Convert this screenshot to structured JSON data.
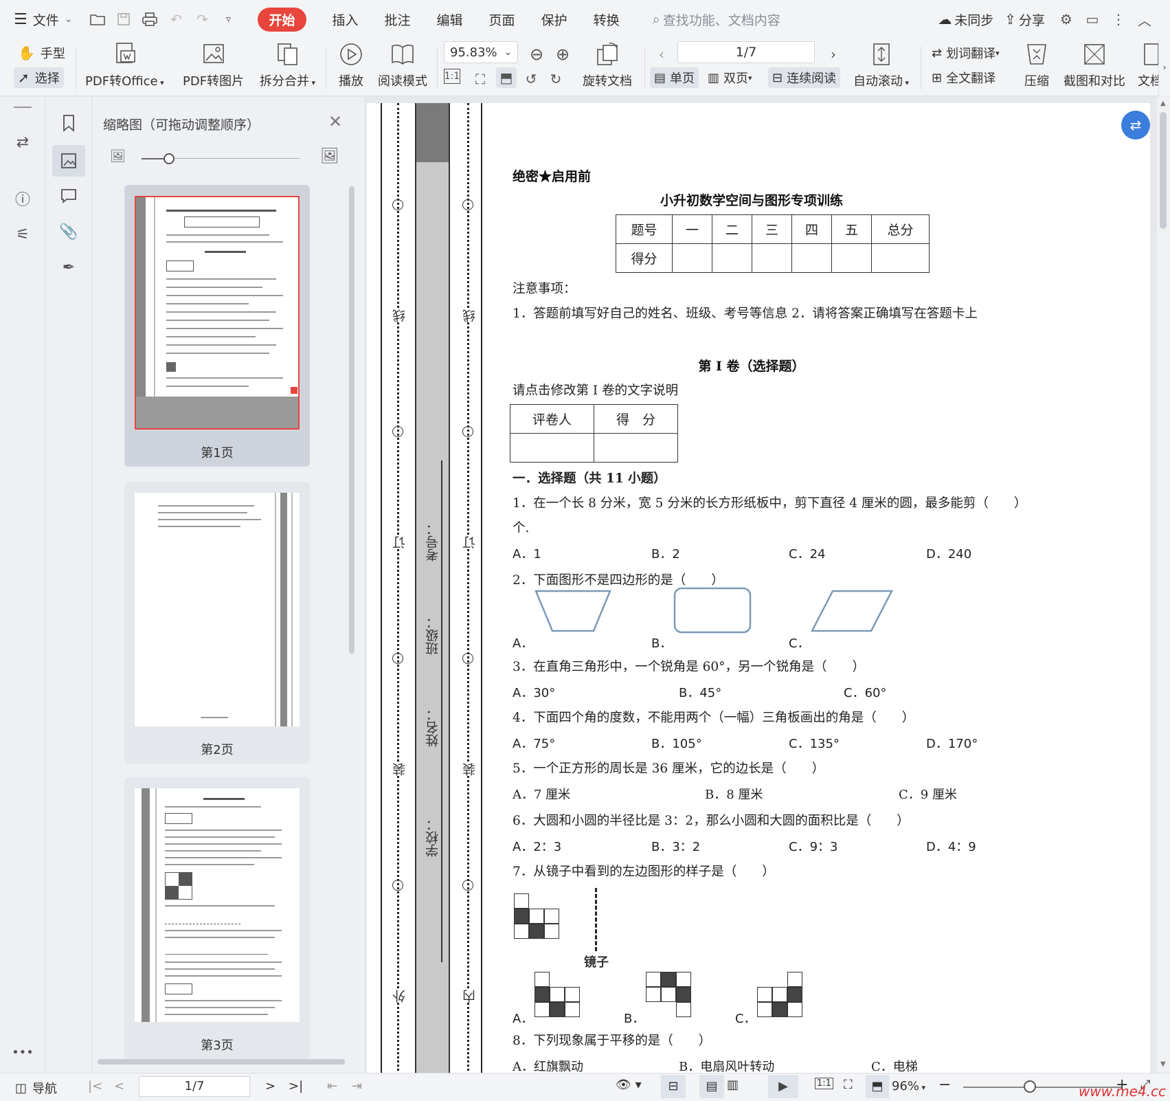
{
  "menu": {
    "file": "文件",
    "tabs": [
      "开始",
      "插入",
      "批注",
      "编辑",
      "页面",
      "保护",
      "转换"
    ],
    "active_tab": "开始",
    "search_placeholder": "查找功能、文档内容",
    "sync": "未同步",
    "share": "分享"
  },
  "ribbon": {
    "hand": "手型",
    "select": "选择",
    "pdf_to_office": "PDF转Office",
    "pdf_to_image": "PDF转图片",
    "split_merge": "拆分合并",
    "play": "播放",
    "read_mode": "阅读模式",
    "zoom": "95.83%",
    "rotate": "旋转文档",
    "page_input": "1/7",
    "single": "单页",
    "double": "双页",
    "continuous": "连续阅读",
    "auto_scroll": "自动滚动",
    "word_translate": "划词翻译",
    "full_translate": "全文翻译",
    "compress": "压缩",
    "screenshot_compare": "截图和对比",
    "doc_cut": "文档"
  },
  "thumbnail_panel": {
    "title": "缩略图（可拖动调整顺序）",
    "pages": [
      "第1页",
      "第2页",
      "第3页"
    ]
  },
  "paper": {
    "secret": "绝密★启用前",
    "title": "小升初数学空间与图形专项训练",
    "score_table": {
      "headers": [
        "题号",
        "一",
        "二",
        "三",
        "四",
        "五",
        "总分"
      ],
      "row2": [
        "得分",
        "",
        "",
        "",
        "",
        "",
        ""
      ]
    },
    "notice_title": "注意事项：",
    "notice": "1．答题前填写好自己的姓名、班级、考号等信息 2．请将答案正确填写在答题卡上",
    "part1_title": "第 I 卷（选择题）",
    "part1_desc": "请点击修改第 I 卷的文字说明",
    "grader": [
      "评卷人",
      "得　分"
    ],
    "section1": "一．选择题（共 11 小题）",
    "q1": "1．在一个长 8 分米，宽 5 分米的长方形纸板中，剪下直径 4 厘米的圆，最多能剪（　　）",
    "q1_cont": "个.",
    "q1_opts": [
      "A．1",
      "B．2",
      "C．24",
      "D．240"
    ],
    "q2": "2．下面图形不是四边形的是（　　）",
    "q2_opts": [
      "A．",
      "B．",
      "C．"
    ],
    "q3": "3．在直角三角形中，一个锐角是 60°，另一个锐角是（　　）",
    "q3_opts": [
      "A．30°",
      "B．45°",
      "C．60°"
    ],
    "q4": "4．下面四个角的度数，不能用两个（一幅）三角板画出的角是（　　）",
    "q4_opts": [
      "A．75°",
      "B．105°",
      "C．135°",
      "D．170°"
    ],
    "q5": "5．一个正方形的周长是 36 厘米，它的边长是（　　）",
    "q5_opts": [
      "A．7 厘米",
      "B．8 厘米",
      "C．9 厘米"
    ],
    "q6": "6．大圆和小圆的半径比是 3：2，那么小圆和大圆的面积比是（　　）",
    "q6_opts": [
      "A．2：3",
      "B．3：2",
      "C．9：3",
      "D．4：9"
    ],
    "q7": "7．从镜子中看到的左边图形的样子是（　　）",
    "mirror": "镜子",
    "q7_opts": [
      "A．",
      "B．",
      "C．"
    ],
    "q8": "8．下列现象属于平移的是（　　）",
    "q8_opts": [
      "A．红旗飘动",
      "B．电扇风叶转动",
      "C．电梯"
    ]
  },
  "binding_strip": {
    "outer_labels": [
      "线",
      "订",
      "装",
      "外"
    ],
    "inner_labels": [
      "线",
      "订",
      "装",
      "内"
    ],
    "fields": [
      "考号：",
      "班级：",
      "姓名：",
      "学校："
    ]
  },
  "status": {
    "nav": "导航",
    "page": "1/7",
    "zoom": "96%"
  },
  "watermark": "www.me4.cc",
  "colors": {
    "accent": "#e8453c",
    "fab": "#3b7ddd"
  }
}
